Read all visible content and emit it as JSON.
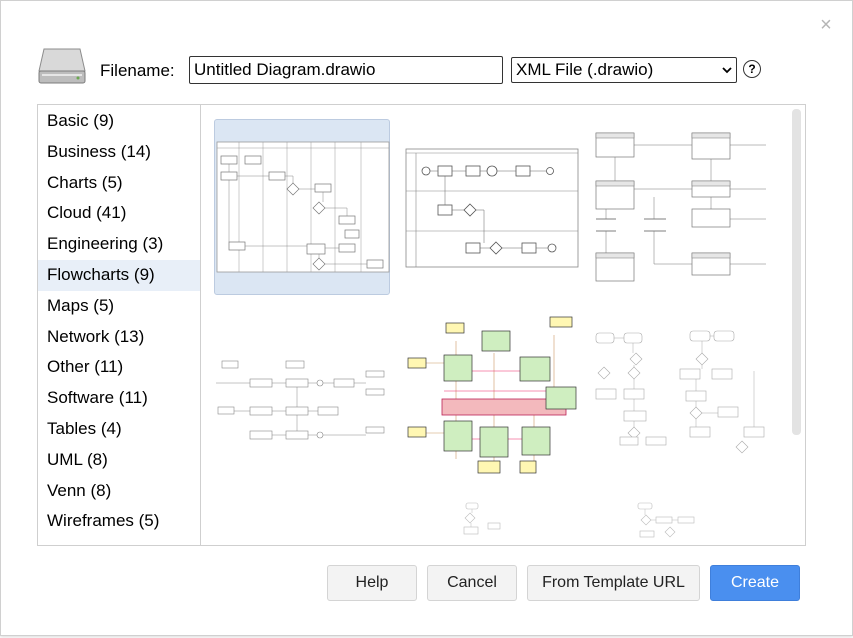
{
  "dialog": {
    "close_symbol": "×",
    "filename_label": "Filename:",
    "filename_value": "Untitled Diagram.drawio",
    "format_selected": "XML File (.drawio)",
    "help_symbol": "?",
    "drive_icon": "hard-drive-icon"
  },
  "categories": [
    {
      "label": "Basic (9)"
    },
    {
      "label": "Business (14)"
    },
    {
      "label": "Charts (5)"
    },
    {
      "label": "Cloud (41)"
    },
    {
      "label": "Engineering (3)"
    },
    {
      "label": "Flowcharts (9)",
      "selected": true
    },
    {
      "label": "Maps (5)"
    },
    {
      "label": "Network (13)"
    },
    {
      "label": "Other (11)"
    },
    {
      "label": "Software (11)"
    },
    {
      "label": "Tables (4)"
    },
    {
      "label": "UML (8)"
    },
    {
      "label": "Venn (8)"
    },
    {
      "label": "Wireframes (5)"
    }
  ],
  "templates": {
    "selected_index": 0,
    "accent": "#dbe6f3"
  },
  "buttons": {
    "help": "Help",
    "cancel": "Cancel",
    "from_template_url": "From Template URL",
    "create": "Create"
  },
  "colors": {
    "primary": "#4a8fef",
    "selected_category": "#e8eff8"
  }
}
